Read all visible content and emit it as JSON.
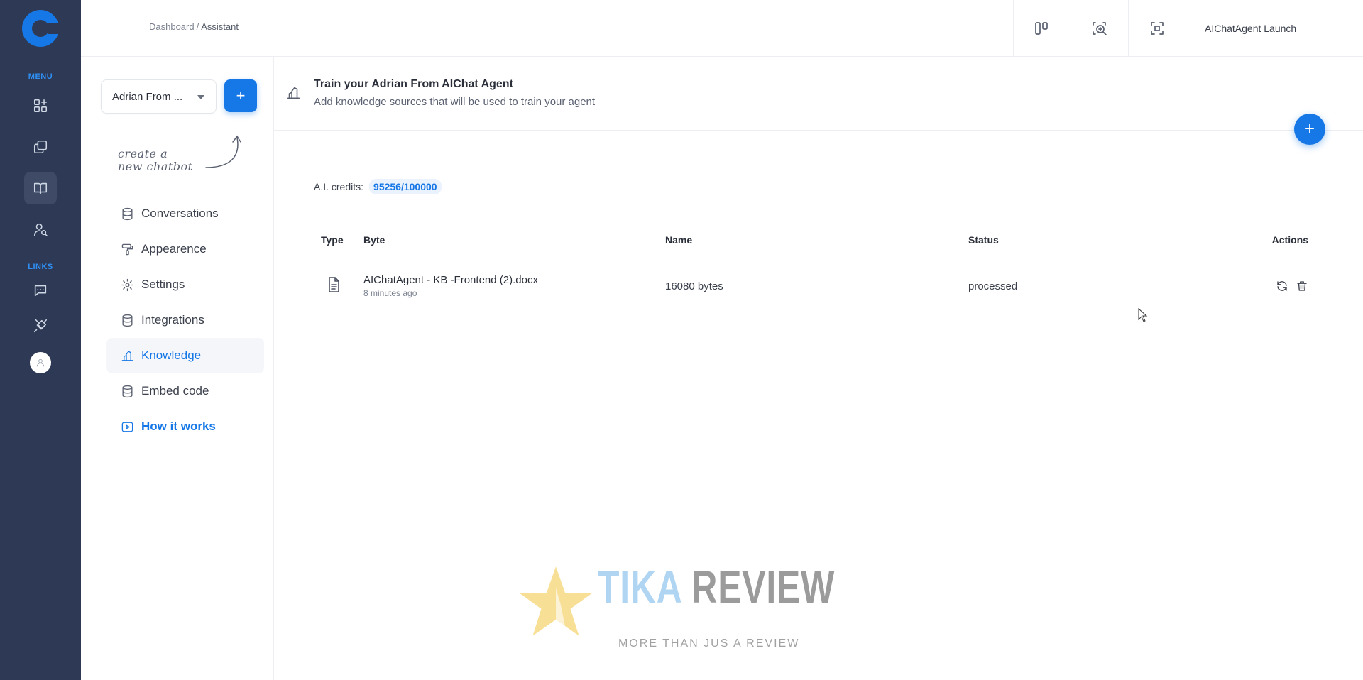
{
  "rail": {
    "menu_label": "MENU",
    "links_label": "LINKS",
    "menu_icons": [
      "apps-icon",
      "copy-icon",
      "book-icon",
      "user-search-icon"
    ],
    "link_icons": [
      "chat-icon",
      "plug-icon"
    ]
  },
  "breadcrumb": {
    "root": "Dashboard",
    "separator": "/",
    "current": "Assistant"
  },
  "topbar": {
    "launch_label": "AIChatAgent Launch"
  },
  "sidebar": {
    "bot_select_value": "Adrian From ...",
    "add_label": "+",
    "hint_line1": "create a",
    "hint_line2": "new chatbot",
    "items": [
      {
        "label": "Conversations",
        "icon": "database-icon"
      },
      {
        "label": "Appearence",
        "icon": "paint-roller-icon"
      },
      {
        "label": "Settings",
        "icon": "gear-icon"
      },
      {
        "label": "Integrations",
        "icon": "database-icon"
      },
      {
        "label": "Knowledge",
        "icon": "knowledge-icon",
        "active": true
      },
      {
        "label": "Embed code",
        "icon": "database-icon"
      },
      {
        "label": "How it works",
        "icon": "video-icon"
      }
    ]
  },
  "main": {
    "title": "Train your Adrian From AIChat Agent",
    "subtitle": "Add knowledge sources that will be used to train your agent",
    "fab_label": "+",
    "credits_label": "A.I. credits:",
    "credits_value": "95256/100000",
    "table": {
      "headers": {
        "type": "Type",
        "byte": "Byte",
        "name": "Name",
        "status": "Status",
        "actions": "Actions"
      },
      "rows": [
        {
          "file": "AIChatAgent - KB -Frontend (2).docx",
          "time": "8 minutes ago",
          "size": "16080 bytes",
          "status": "processed"
        }
      ]
    }
  },
  "watermark": {
    "word1": "TIKA",
    "word2": "REVIEW",
    "tagline": "MORE THAN JUS A REVIEW"
  },
  "colors": {
    "rail_bg": "#2e3a55",
    "accent": "#1677e6",
    "active_bg": "#f4f6fa"
  }
}
